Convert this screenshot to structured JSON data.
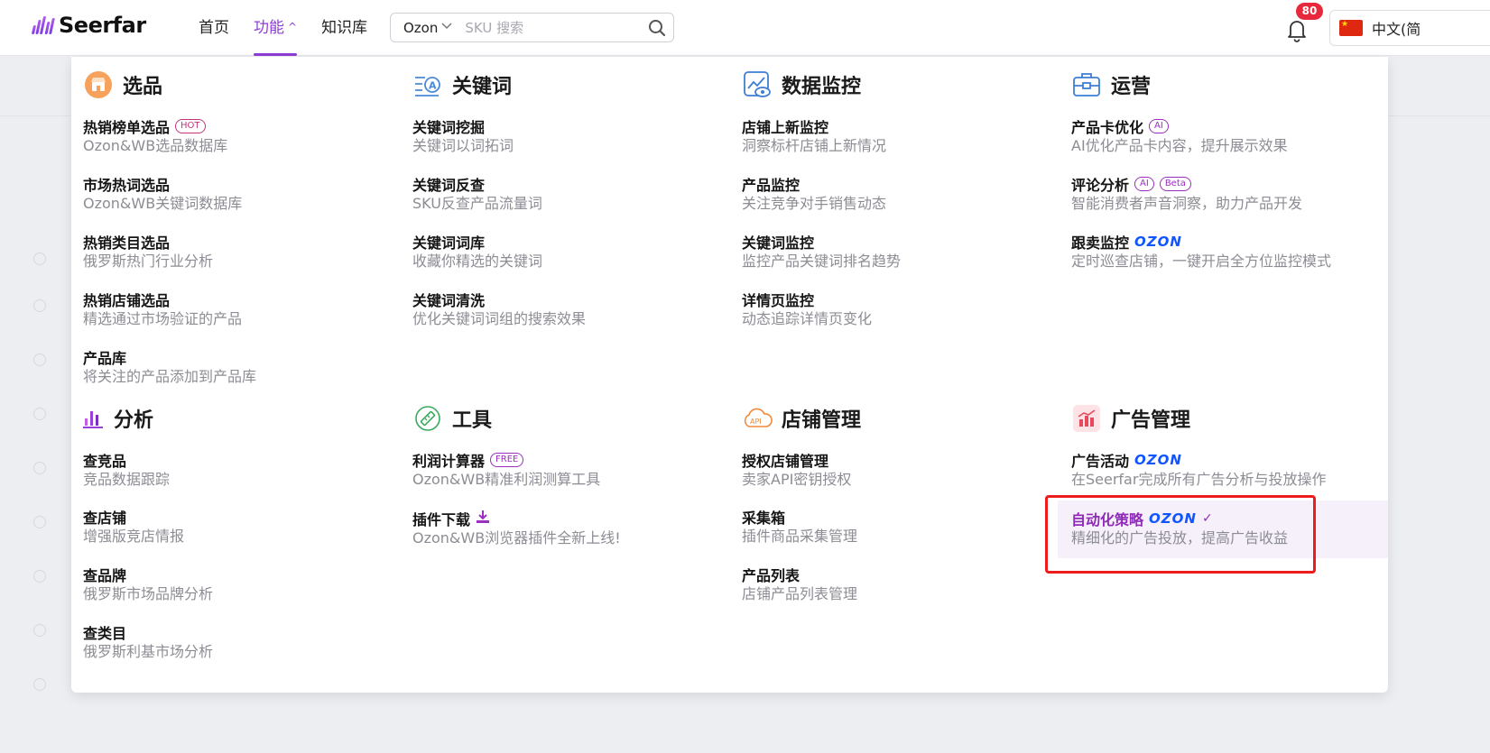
{
  "brand": {
    "name": "Seerfar"
  },
  "nav": {
    "items": [
      {
        "label": "首页"
      },
      {
        "label": "功能",
        "active": true,
        "caret": "^"
      },
      {
        "label": "知识库"
      }
    ]
  },
  "search": {
    "platform": "Ozon",
    "placeholder": "SKU 搜索",
    "value": ""
  },
  "notifications": {
    "count": "80"
  },
  "language": {
    "label": "中文(简"
  },
  "menu": {
    "categories": [
      {
        "title": "选品",
        "icon": "shop-icon",
        "items": [
          {
            "title": "热销榜单选品",
            "tag": "HOT",
            "desc": "Ozon&WB选品数据库"
          },
          {
            "title": "市场热词选品",
            "desc": "Ozon&WB关键词数据库"
          },
          {
            "title": "热销类目选品",
            "desc": "俄罗斯热门行业分析"
          },
          {
            "title": "热销店铺选品",
            "desc": "精选通过市场验证的产品"
          },
          {
            "title": "产品库",
            "desc": "将关注的产品添加到产品库"
          }
        ]
      },
      {
        "title": "关键词",
        "icon": "keyword-icon",
        "items": [
          {
            "title": "关键词挖掘",
            "desc": "关键词以词拓词"
          },
          {
            "title": "关键词反查",
            "desc": "SKU反查产品流量词"
          },
          {
            "title": "关键词词库",
            "desc": "收藏你精选的关键词"
          },
          {
            "title": "关键词清洗",
            "desc": "优化关键词词组的搜索效果"
          }
        ]
      },
      {
        "title": "数据监控",
        "icon": "monitor-chart-icon",
        "items": [
          {
            "title": "店铺上新监控",
            "desc": "洞察标杆店铺上新情况"
          },
          {
            "title": "产品监控",
            "desc": "关注竞争对手销售动态"
          },
          {
            "title": "关键词监控",
            "desc": "监控产品关键词排名趋势"
          },
          {
            "title": "详情页监控",
            "desc": "动态追踪详情页变化"
          }
        ]
      },
      {
        "title": "运营",
        "icon": "toolbox-icon",
        "items": [
          {
            "title": "产品卡优化",
            "tag": "AI",
            "desc": "AI优化产品卡内容，提升展示效果"
          },
          {
            "title": "评论分析",
            "tag": "AI",
            "tag2": "Beta",
            "desc": "智能消费者声音洞察，助力产品开发"
          },
          {
            "title": "跟卖监控",
            "brand": "OZON",
            "desc": "定时巡查店铺，一键开启全方位监控模式"
          }
        ]
      },
      {
        "title": "分析",
        "icon": "bar-chart-icon",
        "items": [
          {
            "title": "查竞品",
            "desc": "竞品数据跟踪"
          },
          {
            "title": "查店铺",
            "desc": "增强版竞店情报"
          },
          {
            "title": "查品牌",
            "desc": "俄罗斯市场品牌分析"
          },
          {
            "title": "查类目",
            "desc": "俄罗斯利基市场分析"
          }
        ]
      },
      {
        "title": "工具",
        "icon": "ruler-icon",
        "items": [
          {
            "title": "利润计算器",
            "tag": "FREE",
            "desc": "Ozon&WB精准利润测算工具"
          },
          {
            "title": "插件下载",
            "download": true,
            "desc": "Ozon&WB浏览器插件全新上线!"
          }
        ]
      },
      {
        "title": "店铺管理",
        "icon": "api-cloud-icon",
        "items": [
          {
            "title": "授权店铺管理",
            "desc": "卖家API密钥授权"
          },
          {
            "title": "采集箱",
            "desc": "插件商品采集管理"
          },
          {
            "title": "产品列表",
            "desc": "店铺产品列表管理"
          }
        ]
      },
      {
        "title": "广告管理",
        "icon": "ad-chart-icon",
        "items": [
          {
            "title": "广告活动",
            "brand": "OZON",
            "desc": "在Seerfar完成所有广告分析与投放操作"
          },
          {
            "title": "自动化策略",
            "brand": "OZON",
            "selected": true,
            "desc": "精细化的广告投放，提高广告收益"
          }
        ]
      }
    ]
  },
  "colors": {
    "accent": "#8f3dd6",
    "ozon": "#1055ff",
    "badge": "#e8283c",
    "highlight": "#ee1c1c"
  }
}
